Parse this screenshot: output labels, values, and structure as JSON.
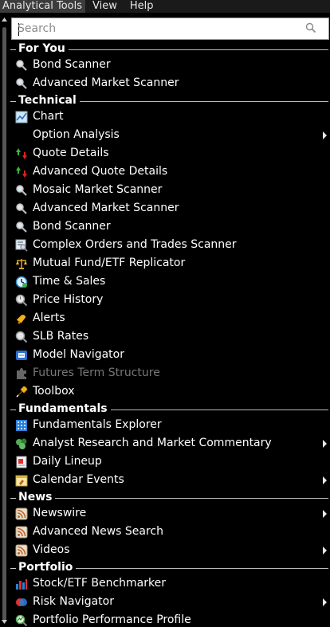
{
  "menubar": {
    "items": [
      "Analytical Tools",
      "View",
      "Help"
    ]
  },
  "search": {
    "placeholder": "Search"
  },
  "sections": {
    "for_you": {
      "title": "For You",
      "items": [
        {
          "label": "Bond Scanner",
          "icon": "magnifier-icon"
        },
        {
          "label": "Advanced Market Scanner",
          "icon": "magnifier-icon"
        }
      ]
    },
    "technical": {
      "title": "Technical",
      "items": [
        {
          "label": "Chart",
          "icon": "chart-icon"
        },
        {
          "label": "Option Analysis",
          "icon": "",
          "submenu": true
        },
        {
          "label": "Quote Details",
          "icon": "up-down-arrows-icon"
        },
        {
          "label": "Advanced Quote Details",
          "icon": "up-down-arrows-icon"
        },
        {
          "label": "Mosaic Market Scanner",
          "icon": "magnifier-icon"
        },
        {
          "label": "Advanced Market Scanner",
          "icon": "magnifier-icon"
        },
        {
          "label": "Bond Scanner",
          "icon": "magnifier-icon"
        },
        {
          "label": "Complex Orders and Trades Scanner",
          "icon": "complex-scanner-icon"
        },
        {
          "label": "Mutual Fund/ETF Replicator",
          "icon": "scales-icon"
        },
        {
          "label": "Time & Sales",
          "icon": "clock-icon"
        },
        {
          "label": "Price History",
          "icon": "history-magnifier-icon"
        },
        {
          "label": "Alerts",
          "icon": "bell-icon"
        },
        {
          "label": "SLB Rates",
          "icon": "magnifier-icon"
        },
        {
          "label": "Model Navigator",
          "icon": "model-icon"
        },
        {
          "label": "Futures Term Structure",
          "icon": "puzzle-icon",
          "disabled": true
        },
        {
          "label": "Toolbox",
          "icon": "wrench-icon"
        }
      ]
    },
    "fundamentals": {
      "title": "Fundamentals",
      "items": [
        {
          "label": "Fundamentals Explorer",
          "icon": "building-icon"
        },
        {
          "label": "Analyst Research and Market Commentary",
          "icon": "research-icon",
          "submenu": true
        },
        {
          "label": "Daily Lineup",
          "icon": "lineup-icon"
        },
        {
          "label": "Calendar Events",
          "icon": "calendar-icon",
          "submenu": true
        }
      ]
    },
    "news": {
      "title": "News",
      "items": [
        {
          "label": "Newswire",
          "icon": "rss-icon",
          "submenu": true
        },
        {
          "label": "Advanced News Search",
          "icon": "rss-icon"
        },
        {
          "label": "Videos",
          "icon": "rss-icon",
          "submenu": true
        }
      ]
    },
    "portfolio": {
      "title": "Portfolio",
      "items": [
        {
          "label": "Stock/ETF Benchmarker",
          "icon": "bar-chart-icon"
        },
        {
          "label": "Risk Navigator",
          "icon": "risk-icon",
          "submenu": true
        },
        {
          "label": "Portfolio Performance Profile",
          "icon": "performance-icon"
        }
      ]
    }
  }
}
